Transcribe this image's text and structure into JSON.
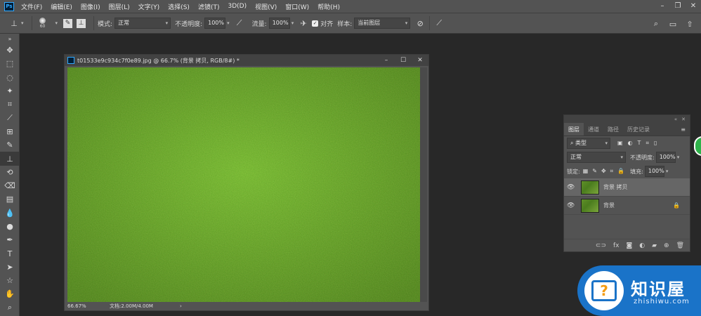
{
  "menubar": {
    "items": [
      "文件(F)",
      "编辑(E)",
      "图像(I)",
      "图层(L)",
      "文字(Y)",
      "选择(S)",
      "滤镜(T)",
      "3D(D)",
      "视图(V)",
      "窗口(W)",
      "帮助(H)"
    ]
  },
  "options": {
    "brush_size": "60",
    "mode_label": "模式:",
    "mode_value": "正常",
    "opacity_label": "不透明度:",
    "opacity_value": "100%",
    "flow_label": "流量:",
    "flow_value": "100%",
    "align_label": "对齐",
    "sample_label": "样本:",
    "sample_value": "当前图层"
  },
  "document": {
    "title": "t01533e9c934c7f0e89.jpg @ 66.7% (背景 拷贝, RGB/8#) *",
    "zoom": "66.67%",
    "doc_info": "文档:2.00M/4.00M"
  },
  "layers_panel": {
    "tabs": [
      "图层",
      "通道",
      "路径",
      "历史记录"
    ],
    "filter_label": "类型",
    "blend_mode": "正常",
    "opacity_label": "不透明度:",
    "opacity_value": "100%",
    "lock_label": "锁定:",
    "fill_label": "填充:",
    "fill_value": "100%",
    "layers": [
      {
        "name": "背景 拷贝",
        "selected": true
      },
      {
        "name": "背景",
        "selected": false
      }
    ]
  },
  "watermark": {
    "title": "知识屋",
    "sub": "zhishiwu.com",
    "icon_glyph": "?"
  }
}
